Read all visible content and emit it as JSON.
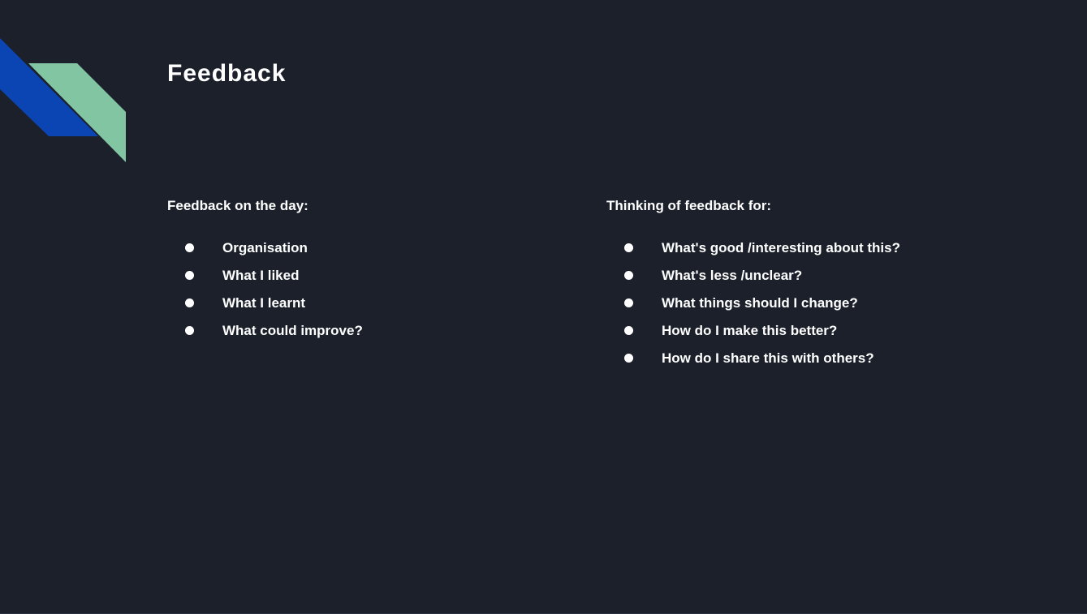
{
  "slide": {
    "title": "Feedback",
    "colors": {
      "background": "#1b202b",
      "text": "#ffffff",
      "accent_blue": "#0b45b3",
      "accent_green": "#82c5a3"
    }
  },
  "left_column": {
    "heading": "Feedback on the day:",
    "items": [
      "Organisation",
      "What I liked",
      "What I learnt",
      "What could improve?"
    ]
  },
  "right_column": {
    "heading": "Thinking of feedback for:",
    "items": [
      "What's good /interesting about this?",
      "What's less /unclear?",
      "What things should I change?",
      "How do I make this better?",
      "How do I share this with others?"
    ]
  }
}
